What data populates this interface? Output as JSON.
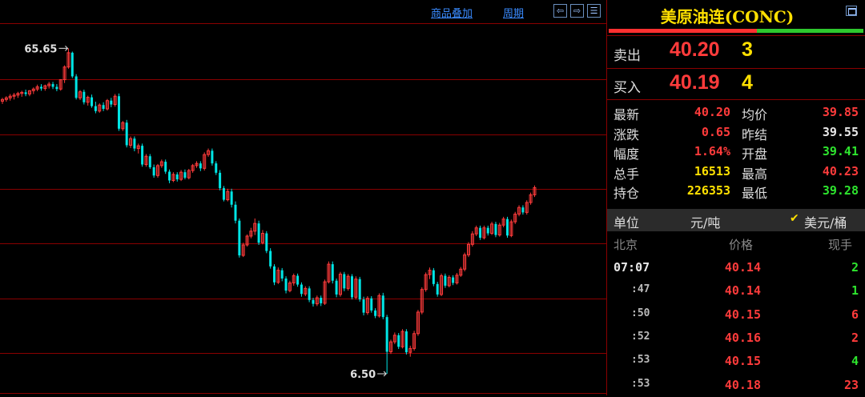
{
  "toolbar": {
    "overlay_label": "商品叠加",
    "period_label": "周期"
  },
  "chart": {
    "high_label": "65.65",
    "low_label": "6.50",
    "colors": {
      "up": "#ff3b3b",
      "down": "#00e5e5",
      "grid": "#8a0000"
    }
  },
  "chart_data": {
    "type": "candlestick",
    "annotations": [
      "65.65",
      "6.50"
    ],
    "bars": [
      [
        56.0,
        56.6,
        55.5,
        56.3
      ],
      [
        56.3,
        56.9,
        55.9,
        56.6
      ],
      [
        56.6,
        57.3,
        56.1,
        56.9
      ],
      [
        56.9,
        57.5,
        56.3,
        57.1
      ],
      [
        57.1,
        57.7,
        56.6,
        57.4
      ],
      [
        57.4,
        57.9,
        56.8,
        57.6
      ],
      [
        57.6,
        58.1,
        56.9,
        57.3
      ],
      [
        57.3,
        58.0,
        56.9,
        57.9
      ],
      [
        57.9,
        58.5,
        57.3,
        58.2
      ],
      [
        58.2,
        59.0,
        57.8,
        58.6
      ],
      [
        58.6,
        59.1,
        57.9,
        58.3
      ],
      [
        58.3,
        59.0,
        57.9,
        58.8
      ],
      [
        58.8,
        59.5,
        58.3,
        59.1
      ],
      [
        59.1,
        59.5,
        58.2,
        58.6
      ],
      [
        58.6,
        59.1,
        57.8,
        58.2
      ],
      [
        58.2,
        60.0,
        57.9,
        59.9
      ],
      [
        59.9,
        62.5,
        59.3,
        62.2
      ],
      [
        62.2,
        65.6,
        61.9,
        64.8
      ],
      [
        64.8,
        65.0,
        60.2,
        60.5
      ],
      [
        60.5,
        60.9,
        56.3,
        56.6
      ],
      [
        56.6,
        58.0,
        56.2,
        57.7
      ],
      [
        57.7,
        58.1,
        55.4,
        55.8
      ],
      [
        55.8,
        57.0,
        55.2,
        56.7
      ],
      [
        56.7,
        57.2,
        54.8,
        55.1
      ],
      [
        55.1,
        55.9,
        53.8,
        54.2
      ],
      [
        54.2,
        55.6,
        53.9,
        55.3
      ],
      [
        55.3,
        55.8,
        54.2,
        54.6
      ],
      [
        54.6,
        56.4,
        54.3,
        56.1
      ],
      [
        56.1,
        56.6,
        54.9,
        55.4
      ],
      [
        55.4,
        57.3,
        55.0,
        56.9
      ],
      [
        56.9,
        57.4,
        50.6,
        51.0
      ],
      [
        51.0,
        52.4,
        50.6,
        52.1
      ],
      [
        52.1,
        52.6,
        47.6,
        48.0
      ],
      [
        48.0,
        49.6,
        47.5,
        49.2
      ],
      [
        49.2,
        49.6,
        46.9,
        47.4
      ],
      [
        47.4,
        48.3,
        46.5,
        47.9
      ],
      [
        47.9,
        48.3,
        44.1,
        44.5
      ],
      [
        44.5,
        46.4,
        44.1,
        46.0
      ],
      [
        46.0,
        46.4,
        43.7,
        44.0
      ],
      [
        44.0,
        44.5,
        42.1,
        42.5
      ],
      [
        42.5,
        44.6,
        42.1,
        44.3
      ],
      [
        44.3,
        45.4,
        43.9,
        45.0
      ],
      [
        45.0,
        45.4,
        42.8,
        43.2
      ],
      [
        43.2,
        43.6,
        41.1,
        41.6
      ],
      [
        41.6,
        43.1,
        41.3,
        42.7
      ],
      [
        42.7,
        43.1,
        41.4,
        41.8
      ],
      [
        41.8,
        43.5,
        41.5,
        43.1
      ],
      [
        43.1,
        43.6,
        41.8,
        42.1
      ],
      [
        42.1,
        43.7,
        41.8,
        43.4
      ],
      [
        43.4,
        44.6,
        43.0,
        44.3
      ],
      [
        44.3,
        45.1,
        43.9,
        44.7
      ],
      [
        44.7,
        45.1,
        43.3,
        43.8
      ],
      [
        43.8,
        46.7,
        43.4,
        46.3
      ],
      [
        46.3,
        47.4,
        45.9,
        47.0
      ],
      [
        47.0,
        47.4,
        44.3,
        44.7
      ],
      [
        44.7,
        45.1,
        42.6,
        43.0
      ],
      [
        43.0,
        43.5,
        39.8,
        40.2
      ],
      [
        40.2,
        40.6,
        37.8,
        38.1
      ],
      [
        38.1,
        40.1,
        37.8,
        39.6
      ],
      [
        39.6,
        40.1,
        36.7,
        37.2
      ],
      [
        37.2,
        37.8,
        33.8,
        34.3
      ],
      [
        34.3,
        34.7,
        27.6,
        28.0
      ],
      [
        28.0,
        30.3,
        27.7,
        29.9
      ],
      [
        29.9,
        31.8,
        29.6,
        31.5
      ],
      [
        31.5,
        33.0,
        31.1,
        32.4
      ],
      [
        32.4,
        34.7,
        31.7,
        33.8
      ],
      [
        33.8,
        34.3,
        29.9,
        30.3
      ],
      [
        30.3,
        32.6,
        30.0,
        32.0
      ],
      [
        32.0,
        32.4,
        28.4,
        28.8
      ],
      [
        28.8,
        29.3,
        25.6,
        26.0
      ],
      [
        26.0,
        26.4,
        22.6,
        23.1
      ],
      [
        23.1,
        25.8,
        22.8,
        25.3
      ],
      [
        25.3,
        25.7,
        23.3,
        23.8
      ],
      [
        23.8,
        24.2,
        21.1,
        21.6
      ],
      [
        21.6,
        23.4,
        21.3,
        23.0
      ],
      [
        23.0,
        24.7,
        22.5,
        24.3
      ],
      [
        24.3,
        24.7,
        22.3,
        22.7
      ],
      [
        22.7,
        23.1,
        20.5,
        21.0
      ],
      [
        21.0,
        22.4,
        20.6,
        22.0
      ],
      [
        22.0,
        22.4,
        19.5,
        19.9
      ],
      [
        19.9,
        20.3,
        18.7,
        19.2
      ],
      [
        19.2,
        20.7,
        18.8,
        20.3
      ],
      [
        20.3,
        20.7,
        18.8,
        19.3
      ],
      [
        19.3,
        23.6,
        19.0,
        23.2
      ],
      [
        23.2,
        26.9,
        22.9,
        26.4
      ],
      [
        26.4,
        26.9,
        22.9,
        23.4
      ],
      [
        23.4,
        23.8,
        20.4,
        20.9
      ],
      [
        20.9,
        25.0,
        20.5,
        24.6
      ],
      [
        24.6,
        25.0,
        21.5,
        22.0
      ],
      [
        22.0,
        24.6,
        21.6,
        24.2
      ],
      [
        24.2,
        24.6,
        20.0,
        20.4
      ],
      [
        20.4,
        24.2,
        20.0,
        23.7
      ],
      [
        23.7,
        24.1,
        19.6,
        20.0
      ],
      [
        20.0,
        20.5,
        17.1,
        17.6
      ],
      [
        17.6,
        20.6,
        17.2,
        20.2
      ],
      [
        20.2,
        20.6,
        17.6,
        18.0
      ],
      [
        18.0,
        18.4,
        16.6,
        17.0
      ],
      [
        17.0,
        21.1,
        16.7,
        20.7
      ],
      [
        20.7,
        21.2,
        16.4,
        16.8
      ],
      [
        16.8,
        17.2,
        6.5,
        10.5
      ],
      [
        10.5,
        12.7,
        10.1,
        12.3
      ],
      [
        12.3,
        14.0,
        11.9,
        13.5
      ],
      [
        13.5,
        13.9,
        11.0,
        11.4
      ],
      [
        11.4,
        14.6,
        11.1,
        14.2
      ],
      [
        14.2,
        14.6,
        10.0,
        10.4
      ],
      [
        10.4,
        11.6,
        9.6,
        11.1
      ],
      [
        11.1,
        14.3,
        10.7,
        13.8
      ],
      [
        13.8,
        18.1,
        13.4,
        17.7
      ],
      [
        17.7,
        22.2,
        17.3,
        21.8
      ],
      [
        21.8,
        24.9,
        21.4,
        24.5
      ],
      [
        24.5,
        25.8,
        23.7,
        25.3
      ],
      [
        25.3,
        25.7,
        22.4,
        22.8
      ],
      [
        22.8,
        23.2,
        20.5,
        20.9
      ],
      [
        20.9,
        24.7,
        20.6,
        24.3
      ],
      [
        24.3,
        24.7,
        22.1,
        22.5
      ],
      [
        22.5,
        24.4,
        22.2,
        24.0
      ],
      [
        24.0,
        24.4,
        22.6,
        23.0
      ],
      [
        23.0,
        24.8,
        22.7,
        24.4
      ],
      [
        24.4,
        25.9,
        24.1,
        25.5
      ],
      [
        25.5,
        28.5,
        25.1,
        28.1
      ],
      [
        28.1,
        30.4,
        27.7,
        30.0
      ],
      [
        30.0,
        32.4,
        29.6,
        31.9
      ],
      [
        31.9,
        33.4,
        31.5,
        33.0
      ],
      [
        33.0,
        33.4,
        30.8,
        31.2
      ],
      [
        31.2,
        33.4,
        30.9,
        33.0
      ],
      [
        33.0,
        33.4,
        31.6,
        32.0
      ],
      [
        32.0,
        34.1,
        31.7,
        33.7
      ],
      [
        33.7,
        34.1,
        31.3,
        31.7
      ],
      [
        31.7,
        33.9,
        31.4,
        33.5
      ],
      [
        33.5,
        35.0,
        33.1,
        34.6
      ],
      [
        34.6,
        35.0,
        31.2,
        31.6
      ],
      [
        31.6,
        34.5,
        31.3,
        34.1
      ],
      [
        34.1,
        35.9,
        33.7,
        35.5
      ],
      [
        35.5,
        37.1,
        35.1,
        36.7
      ],
      [
        36.7,
        37.1,
        35.4,
        35.8
      ],
      [
        35.8,
        38.0,
        35.4,
        37.6
      ],
      [
        37.6,
        39.4,
        37.2,
        39.0
      ],
      [
        39.0,
        40.7,
        38.6,
        40.3
      ]
    ]
  },
  "panel": {
    "title": "美原油连(CONC)",
    "sell": {
      "label": "卖出",
      "price": "40.20",
      "volume": "3"
    },
    "buy": {
      "label": "买入",
      "price": "40.19",
      "volume": "4"
    },
    "stats": [
      {
        "label": "最新",
        "value": "40.20",
        "color": "#ff3b3b",
        "label2": "均价",
        "value2": "39.85",
        "color2": "#ff3b3b"
      },
      {
        "label": "涨跌",
        "value": "0.65",
        "color": "#ff3b3b",
        "label2": "昨结",
        "value2": "39.55",
        "color2": "#e8e8e8"
      },
      {
        "label": "幅度",
        "value": "1.64%",
        "color": "#ff3b3b",
        "label2": "开盘",
        "value2": "39.41",
        "color2": "#2ee52e"
      },
      {
        "label": "总手",
        "value": "16513",
        "color": "#ffe000",
        "label2": "最高",
        "value2": "40.23",
        "color2": "#ff3b3b"
      },
      {
        "label": "持仓",
        "value": "226353",
        "color": "#ffe000",
        "label2": "最低",
        "value2": "39.28",
        "color2": "#2ee52e"
      }
    ],
    "unit": {
      "label": "单位",
      "option1": "元/吨",
      "option2": "美元/桶",
      "checkmark": "✔"
    },
    "ticks_header": {
      "place": "北京",
      "price": "价格",
      "volume": "现手"
    },
    "ticks": [
      {
        "time": "07:07",
        "price": "40.14",
        "volume": "2",
        "vol_color": "#2ee52e"
      },
      {
        "time": ":47",
        "price": "40.14",
        "volume": "1",
        "vol_color": "#2ee52e"
      },
      {
        "time": ":50",
        "price": "40.15",
        "volume": "6",
        "vol_color": "#ff3b3b"
      },
      {
        "time": ":52",
        "price": "40.16",
        "volume": "2",
        "vol_color": "#ff3b3b"
      },
      {
        "time": ":53",
        "price": "40.15",
        "volume": "4",
        "vol_color": "#2ee52e"
      },
      {
        "time": ":53",
        "price": "40.18",
        "volume": "23",
        "vol_color": "#ff3b3b"
      }
    ]
  }
}
